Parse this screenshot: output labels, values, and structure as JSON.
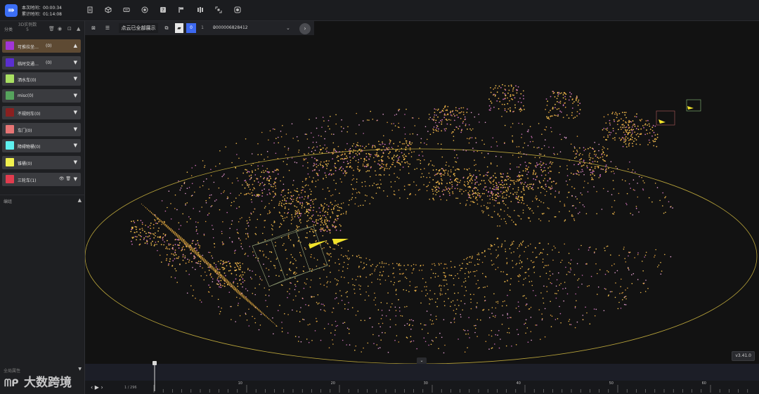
{
  "topbar": {
    "logo_glyph": "⇛",
    "session_time": "本次时间：00:00:34",
    "total_time": "累计时间：01:14:08",
    "tools": [
      "doc-icon",
      "cube-icon",
      "keyboard-icon",
      "target-icon",
      "help-icon",
      "flag-icon",
      "columns-icon",
      "fit-icon",
      "settings-icon"
    ]
  },
  "left_panel": {
    "category_title": "分类",
    "instance_label": "3D实例数",
    "instance_count": "5",
    "categories": [
      {
        "label": "可推拉坐…",
        "count": "(0)",
        "color": "#a235d6",
        "active": true,
        "caret": "▲"
      },
      {
        "label": "临时交通…",
        "count": "(0)",
        "color": "#5a2fd0",
        "active": false,
        "caret": "▼"
      },
      {
        "label": "洒水车(0)",
        "count": "",
        "color": "#a9e062",
        "active": false,
        "caret": "▼"
      },
      {
        "label": "misc(0)",
        "count": "",
        "color": "#56a35d",
        "active": false,
        "caret": "▼"
      },
      {
        "label": "不规则车(0)",
        "count": "",
        "color": "#8a2020",
        "active": false,
        "caret": "▼"
      },
      {
        "label": "车门(0)",
        "count": "",
        "color": "#e87575",
        "active": false,
        "caret": "▼"
      },
      {
        "label": "障碍物桶(0)",
        "count": "",
        "color": "#5ef0ef",
        "active": false,
        "caret": "▼"
      },
      {
        "label": "锥桶(0)",
        "count": "",
        "color": "#f0f04e",
        "active": false,
        "caret": "▼"
      },
      {
        "label": "三轮车(1)",
        "count": "",
        "color": "#e23c4e",
        "active": false,
        "caret": "▼",
        "extra": "👁 🗑"
      }
    ],
    "group_title": "编组",
    "global_attr": "全局属性"
  },
  "viewport": {
    "show_all_label": "点云已全部展示",
    "pages": [
      "0",
      "1",
      "2",
      "3"
    ],
    "current_page": "0",
    "frame_id": "0000006828412",
    "version": "v3.41.0"
  },
  "timeline": {
    "frame_counter": "1 / 296",
    "tick_labels": [
      "10",
      "20",
      "30",
      "40",
      "50",
      "60"
    ]
  },
  "watermark": {
    "text": "大数跨境"
  }
}
